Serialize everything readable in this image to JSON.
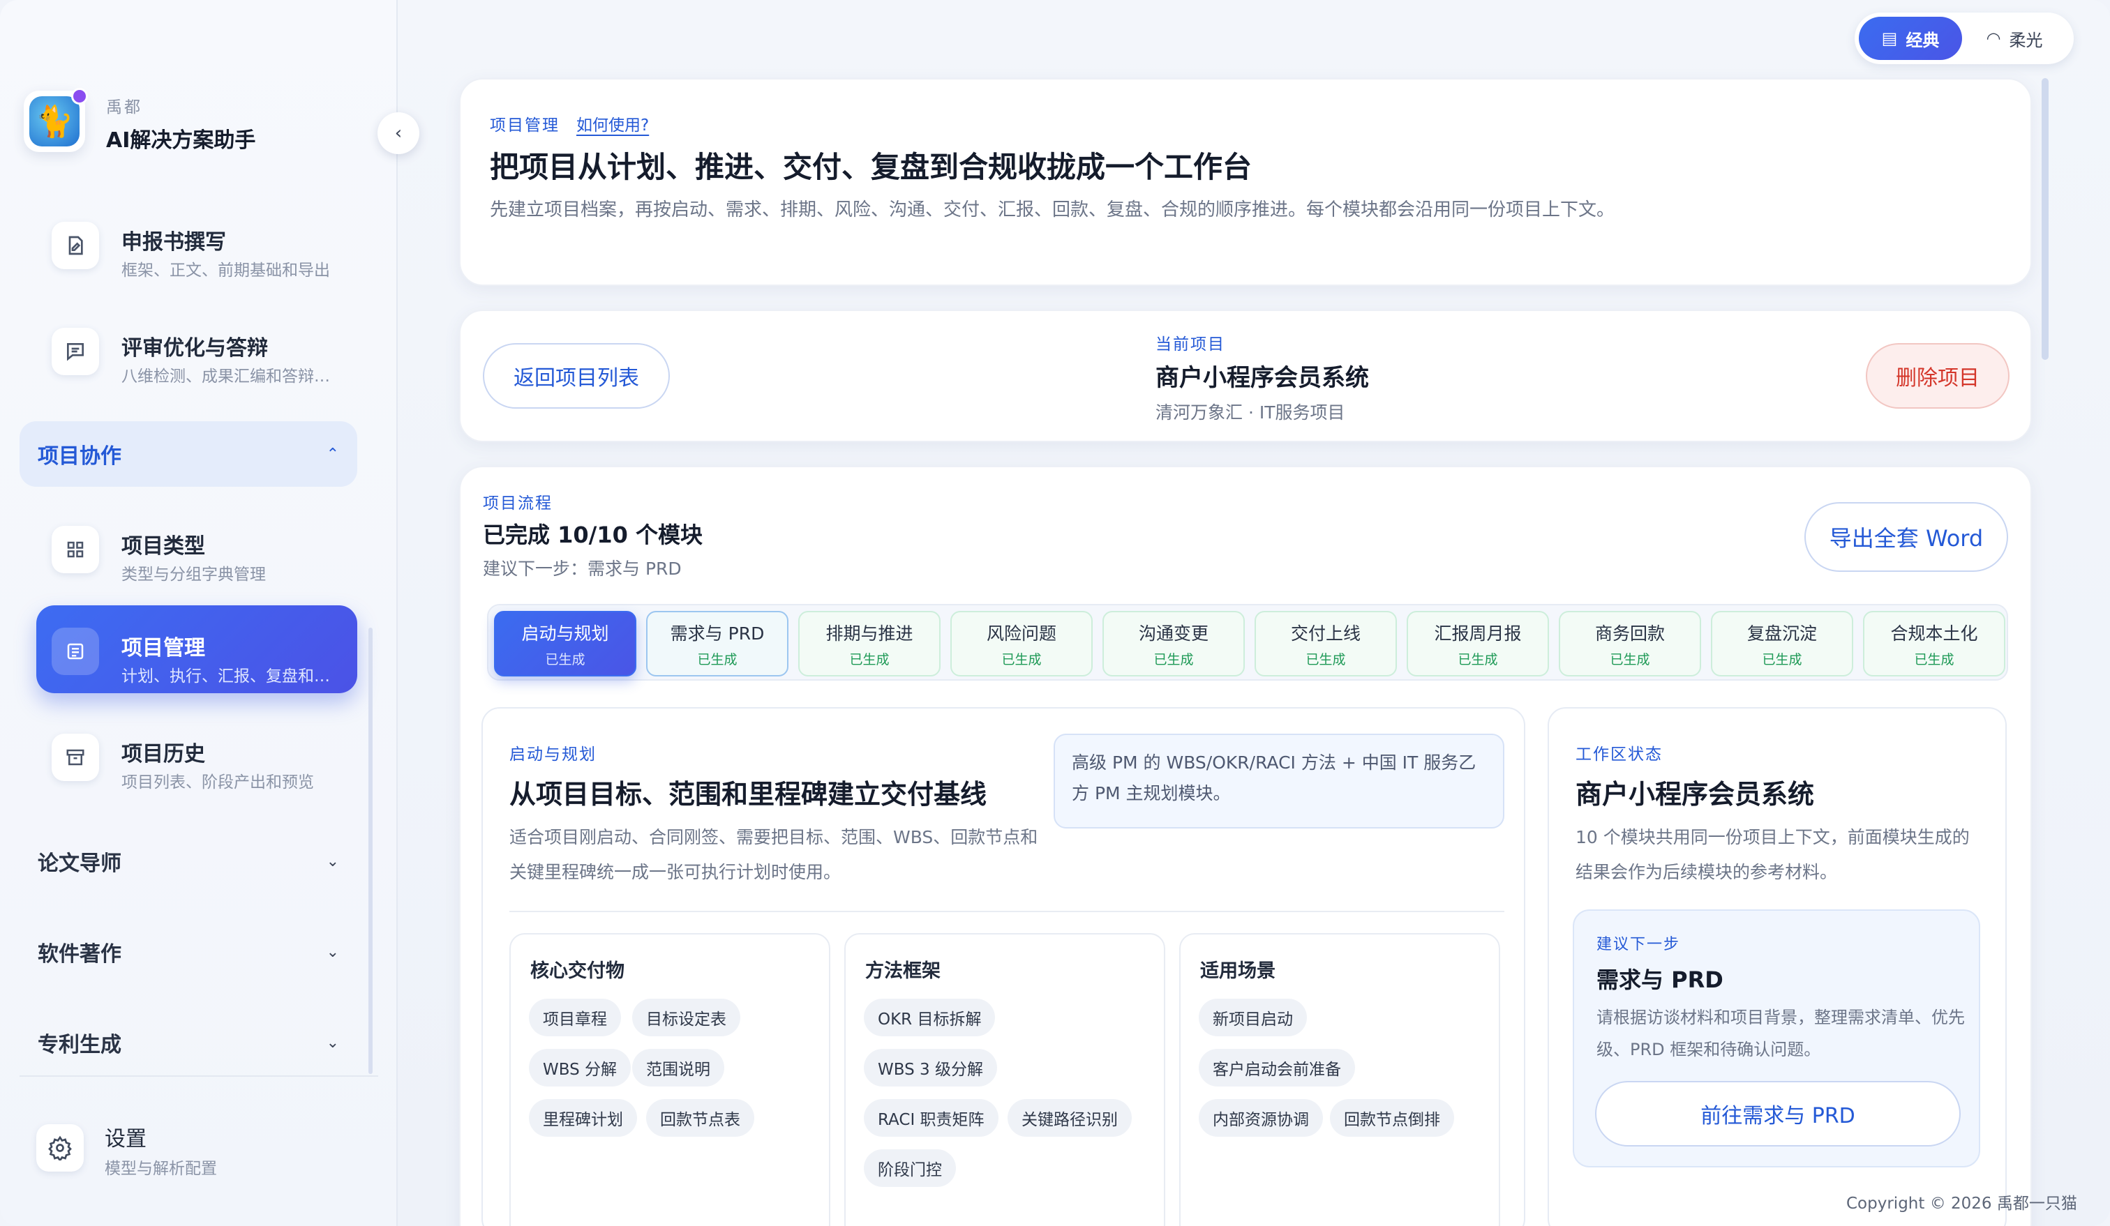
{
  "window": {
    "controls": [
      "close",
      "minimize",
      "zoom"
    ]
  },
  "brand": {
    "subtitle": "禹都",
    "title": "AI解决方案助手",
    "logo_icon": "cat-logo-icon"
  },
  "sidebar": {
    "items": [
      {
        "title": "申报书撰写",
        "desc": "框架、正文、前期基础和导出",
        "icon": "document-edit-icon"
      },
      {
        "title": "评审优化与答辩",
        "desc": "八维检测、成果汇编和答辩…",
        "icon": "message-icon"
      },
      {
        "title": "项目类型",
        "desc": "类型与分组字典管理",
        "icon": "grid-icon"
      },
      {
        "title": "项目管理",
        "desc": "计划、执行、汇报、复盘和…",
        "icon": "table-icon",
        "active": true
      },
      {
        "title": "项目历史",
        "desc": "项目列表、阶段产出和预览",
        "icon": "archive-icon"
      }
    ],
    "groups": [
      {
        "label": "项目协作",
        "open": true
      },
      {
        "label": "论文导师",
        "open": false
      },
      {
        "label": "软件著作",
        "open": false
      },
      {
        "label": "专利生成",
        "open": false
      }
    ],
    "settings": {
      "title": "设置",
      "desc": "模型与解析配置",
      "icon": "gear-icon"
    }
  },
  "theme_toggle": {
    "options": [
      "经典",
      "柔光"
    ],
    "selected": "经典"
  },
  "header_card": {
    "eyebrow": "项目管理",
    "how_to": "如何使用?",
    "title": "把项目从计划、推进、交付、复盘到合规收拢成一个工作台",
    "description": "先建立项目档案，再按启动、需求、排期、风险、沟通、交付、汇报、回款、复盘、合规的顺序推进。每个模块都会沿用同一份项目上下文。"
  },
  "project_bar": {
    "back_label": "返回项目列表",
    "current_label": "当前项目",
    "project_name": "商户小程序会员系统",
    "project_meta": "清河万象汇 · IT服务项目",
    "delete_label": "删除项目"
  },
  "flow": {
    "eyebrow": "项目流程",
    "progress": "已完成 10/10 个模块",
    "suggest": "建议下一步：需求与 PRD",
    "export_label": "导出全套 Word",
    "steps": [
      {
        "label": "启动与规划",
        "status": "已生成"
      },
      {
        "label": "需求与 PRD",
        "status": "已生成"
      },
      {
        "label": "排期与推进",
        "status": "已生成"
      },
      {
        "label": "风险问题",
        "status": "已生成"
      },
      {
        "label": "沟通变更",
        "status": "已生成"
      },
      {
        "label": "交付上线",
        "status": "已生成"
      },
      {
        "label": "汇报周月报",
        "status": "已生成"
      },
      {
        "label": "商务回款",
        "status": "已生成"
      },
      {
        "label": "复盘沉淀",
        "status": "已生成"
      },
      {
        "label": "合规本土化",
        "status": "已生成"
      }
    ]
  },
  "module": {
    "eyebrow": "启动与规划",
    "title": "从项目目标、范围和里程碑建立交付基线",
    "description": "适合项目刚启动、合同刚签、需要把目标、范围、WBS、回款节点和关键里程碑统一成一张可执行计划时使用。",
    "note": "高级 PM 的 WBS/OKR/RACI 方法 + 中国 IT 服务乙方 PM 主规划模块。",
    "deliverables": {
      "title": "核心交付物",
      "chips": [
        "项目章程",
        "目标设定表",
        "WBS 分解",
        "范围说明",
        "里程碑计划",
        "回款节点表"
      ]
    },
    "methods": {
      "title": "方法框架",
      "chips": [
        "OKR 目标拆解",
        "WBS 3 级分解",
        "RACI 职责矩阵",
        "关键路径识别",
        "阶段门控"
      ]
    },
    "scenarios": {
      "title": "适用场景",
      "chips": [
        "新项目启动",
        "客户启动会前准备",
        "内部资源协调",
        "回款节点倒排"
      ]
    }
  },
  "workspace": {
    "eyebrow": "工作区状态",
    "title": "商户小程序会员系统",
    "description": "10 个模块共用同一份项目上下文，前面模块生成的结果会作为后续模块的参考材料。",
    "next_eyebrow": "建议下一步",
    "next_title": "需求与 PRD",
    "next_desc": "请根据访谈材料和项目背景，整理需求清单、优先级、PRD 框架和待确认问题。",
    "next_button": "前往需求与 PRD"
  },
  "footer": {
    "copyright": "Copyright © 2026 禹都一只猫"
  },
  "colors": {
    "accent": "#3b6cf0",
    "success": "#1f9a57",
    "danger": "#d4362a"
  }
}
